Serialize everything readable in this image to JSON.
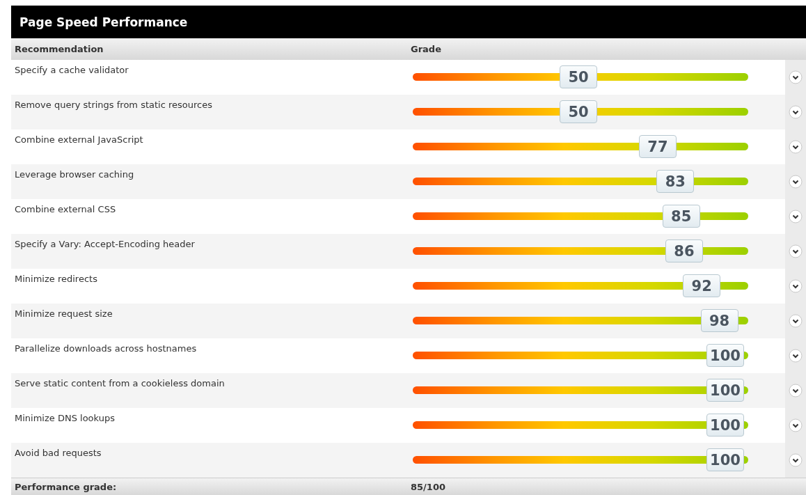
{
  "panel": {
    "title": "Page Speed Performance"
  },
  "columns": [
    "Recommendation",
    "Grade"
  ],
  "rows": [
    {
      "recommendation": "Specify a cache validator",
      "grade": "50",
      "level": 0.5
    },
    {
      "recommendation": "Remove query strings from static resources",
      "grade": "50",
      "level": 0.5
    },
    {
      "recommendation": "Combine external JavaScript",
      "grade": "77",
      "level": 0.77
    },
    {
      "recommendation": "Leverage browser caching",
      "grade": "83",
      "level": 0.83
    },
    {
      "recommendation": "Combine external CSS",
      "grade": "85",
      "level": 0.85
    },
    {
      "recommendation": "Specify a Vary: Accept-Encoding header",
      "grade": "86",
      "level": 0.86
    },
    {
      "recommendation": "Minimize redirects",
      "grade": "92",
      "level": 0.92
    },
    {
      "recommendation": "Minimize request size",
      "grade": "98",
      "level": 0.98
    },
    {
      "recommendation": "Parallelize downloads across hostnames",
      "grade": "100",
      "level": 1
    },
    {
      "recommendation": "Serve static content from a cookieless domain",
      "grade": "100",
      "level": 1
    },
    {
      "recommendation": "Minimize DNS lookups",
      "grade": "100",
      "level": 1
    },
    {
      "recommendation": "Avoid bad requests",
      "grade": "100",
      "level": 1
    }
  ],
  "footer": {
    "label": "Performance grade:",
    "value": "85/100"
  }
}
